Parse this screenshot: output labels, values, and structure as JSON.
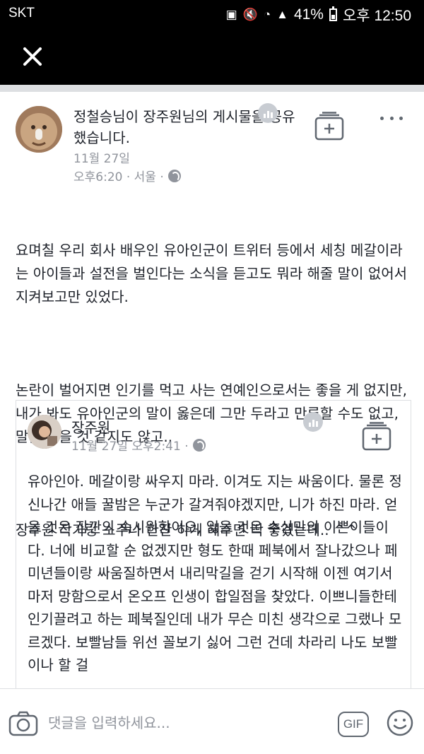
{
  "status_bar": {
    "carrier": "SKT",
    "battery": "41%",
    "time": "오후 12:50"
  },
  "post": {
    "sharer_name": "정철승",
    "sharer_suffix": "님이 ",
    "original_author": "장주원",
    "share_text": "님의 게시물을 공유했습니다.",
    "date": "11월 27일",
    "time_location": "오후6:20 · 서울 ·",
    "body": [
      "요며칠 우리 회사 배우인 유아인군이 트위터 등에서 세칭 메갈이라는 아이들과 설전을 벌인다는 소식을 듣고도 뭐라 해줄 말이 없어서 지켜보고만 있었다.",
      "논란이 벌어지면 인기를 먹고 사는 연예인으로서는 좋을 게 없지만, 내가 봐도 유아인군의 말이 옳은데 그만 두라고 만류할 수도 없고, 말을 들을 것 같지도 않고..",
      "장주원 작가랑 소주나 한잔 하게 해주면 딱 좋겠는데.. ^^"
    ]
  },
  "shared": {
    "author": "장주원",
    "meta": "11월 27일 오후2:41 ·",
    "body": "유아인아. 메갈이랑 싸우지 마라. 이겨도 지는 싸움이다. 물론 정신나간 애들 꿀밤은 누군가 갈겨줘야겠지만, 니가 하진 마라. 얻을 것은 잠깐의 속시원함이오, 잃을 것은 수십만의 이쁜이들이다. 너에 비교할 순 없겠지만 형도 한때 페북에서 잘나갔으나 페미년들이랑 싸움질하면서 내리막길을 걷기 시작해 이젠 여기서마저 망함으로서 온오프 인생이 합일점을 찾았다. 이쁘니들한테 인기끌려고 하는 페북질인데 내가 무슨 미친 생각으로 그랬나 모르겠다. 보빨남들 위선 꼴보기 싫어 그런 건데 차라리 나도 보빨이나 할 걸"
  },
  "comment": {
    "placeholder": "댓글을 입력하세요...",
    "gif_label": "GIF"
  }
}
